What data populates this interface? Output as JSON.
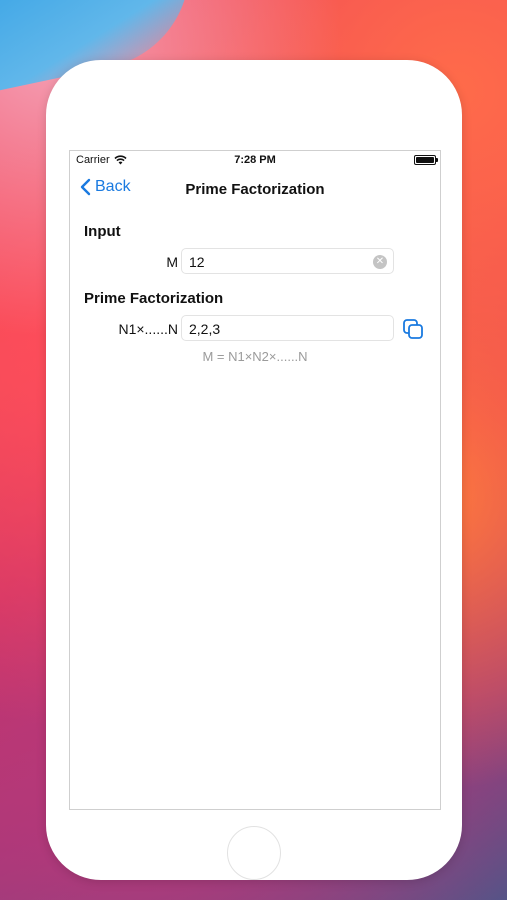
{
  "status_bar": {
    "carrier": "Carrier",
    "time": "7:28 PM"
  },
  "nav": {
    "back_label": "Back",
    "title": "Prime Factorization"
  },
  "input_section": {
    "header": "Input",
    "field_label": "M",
    "field_value": "12"
  },
  "result_section": {
    "header": "Prime Factorization",
    "field_label": "N1×......N",
    "field_value": "2,2,3",
    "hint": "M = N1×N2×......N"
  },
  "colors": {
    "accent": "#1a7ae0",
    "hint_text": "#9b9b9b"
  },
  "icons": [
    "wifi-icon",
    "battery-icon",
    "chevron-left-icon",
    "clear-icon",
    "copy-icon"
  ]
}
